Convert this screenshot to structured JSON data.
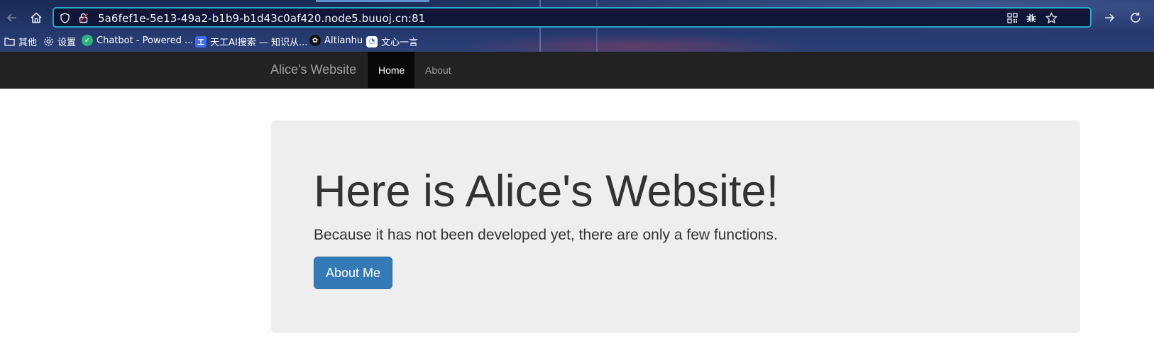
{
  "browser": {
    "url": "5a6fef1e-5e13-49a2-b1b9-b1d43c0af420.node5.buuoj.cn:81",
    "bookmarks": [
      {
        "label": "其他",
        "icon": "folder-icon"
      },
      {
        "label": "设置",
        "icon": "gear-icon"
      },
      {
        "label": "Chatbot - Powered ...",
        "icon": "chatbot-icon"
      },
      {
        "label": "天工AI搜索 — 知识从...",
        "icon": "tiangong-icon"
      },
      {
        "label": "AItianhu",
        "icon": "openai-icon"
      },
      {
        "label": "文心一言",
        "icon": "wenxin-icon"
      }
    ]
  },
  "navbar": {
    "brand": "Alice's Website",
    "items": [
      {
        "label": "Home",
        "active": true
      },
      {
        "label": "About",
        "active": false
      }
    ]
  },
  "jumbotron": {
    "title": "Here is Alice's Website!",
    "text": "Because it has not been developed yet, there are only a few functions.",
    "button_label": "About Me"
  },
  "colors": {
    "navbar_bg": "#222222",
    "jumbotron_bg": "#eeeeee",
    "primary_button": "#337ab7",
    "url_bar_border": "#2aa8c4"
  }
}
